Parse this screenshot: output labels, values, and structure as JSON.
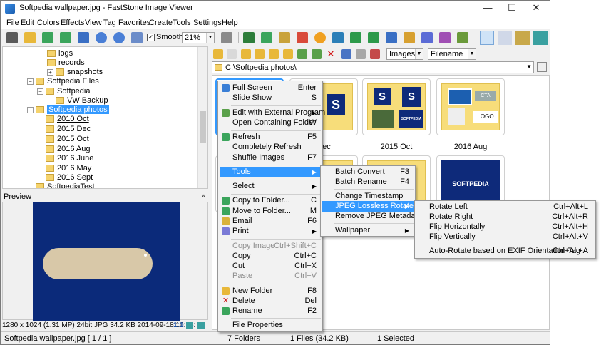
{
  "window": {
    "title": "Softpedia wallpaper.jpg - FastStone Image Viewer",
    "controls": {
      "minimize": "—",
      "maximize": "☐",
      "close": "✕"
    }
  },
  "menubar": [
    "File",
    "Edit",
    "Colors",
    "Effects",
    "View",
    "Tag",
    "Favorites",
    "Create",
    "Tools",
    "Settings",
    "Help"
  ],
  "toolbar": {
    "smooth_label": "Smooth",
    "smooth_checked": "✓",
    "zoom_value": "21%"
  },
  "tree": {
    "items": [
      {
        "label": "logs"
      },
      {
        "label": "records"
      },
      {
        "label": "snapshots"
      },
      {
        "label": "Softpedia Files"
      },
      {
        "label": "Softpedia"
      },
      {
        "label": "VW Backup"
      },
      {
        "label": "Softpedia photos",
        "selected": true
      },
      {
        "label": "2010 Oct"
      },
      {
        "label": "2015 Dec"
      },
      {
        "label": "2015 Oct"
      },
      {
        "label": "2016 Aug"
      },
      {
        "label": "2016 June"
      },
      {
        "label": "2016 May"
      },
      {
        "label": "2016 Sept"
      },
      {
        "label": "SoftpediaTest"
      }
    ]
  },
  "preview": {
    "header": "Preview",
    "info": "1280 x 1024 (1.31 MP)  24bit  JPG   34.2 KB   2014-09-18 10:15:",
    "zoom_ratio": "1:1"
  },
  "browser": {
    "sort_by": "Images",
    "sort_field": "Filename",
    "address": "C:\\Softpedia photos\\",
    "thumbnails": [
      {
        "label": ""
      },
      {
        "label": "Dec"
      },
      {
        "label": "2015 Oct"
      },
      {
        "label": "2016 Aug"
      },
      {
        "label": ""
      },
      {
        "label": ""
      },
      {
        "label": ""
      },
      {
        "label": ""
      }
    ],
    "thumb_texts": {
      "s": "S",
      "cta": "CTA",
      "logo": "LOGO",
      "brand": "SOFTPEDIA",
      "brand_small": "SOFTPEDIA"
    }
  },
  "statusbar": {
    "file": "Softpedia wallpaper.jpg [ 1 / 1 ]",
    "folders": "7 Folders",
    "files": "1 Files (34.2 KB)",
    "selected": "1 Selected"
  },
  "context_menu": {
    "items": [
      {
        "label": "Full Screen",
        "shortcut": "Enter"
      },
      {
        "label": "Slide Show",
        "shortcut": "S"
      },
      {
        "label": "Edit with External Program",
        "shortcut": ""
      },
      {
        "label": "Open Containing Folder",
        "shortcut": "W"
      },
      {
        "label": "Refresh",
        "shortcut": "F5"
      },
      {
        "label": "Completely Refresh",
        "shortcut": ""
      },
      {
        "label": "Shuffle Images",
        "shortcut": "F7"
      },
      {
        "label": "Tools",
        "shortcut": ""
      },
      {
        "label": "Select",
        "shortcut": ""
      },
      {
        "label": "Copy to Folder...",
        "shortcut": "C"
      },
      {
        "label": "Move to Folder...",
        "shortcut": "M"
      },
      {
        "label": "Email",
        "shortcut": "F6"
      },
      {
        "label": "Print",
        "shortcut": ""
      },
      {
        "label": "Copy Image",
        "shortcut": "Ctrl+Shift+C"
      },
      {
        "label": "Copy",
        "shortcut": "Ctrl+C"
      },
      {
        "label": "Cut",
        "shortcut": "Ctrl+X"
      },
      {
        "label": "Paste",
        "shortcut": "Ctrl+V"
      },
      {
        "label": "New Folder",
        "shortcut": "F8"
      },
      {
        "label": "Delete",
        "shortcut": "Del"
      },
      {
        "label": "Rename",
        "shortcut": "F2"
      },
      {
        "label": "File Properties",
        "shortcut": ""
      }
    ]
  },
  "tools_menu": {
    "items": [
      {
        "label": "Batch Convert",
        "shortcut": "F3"
      },
      {
        "label": "Batch Rename",
        "shortcut": "F4"
      },
      {
        "label": "Change Timestamp",
        "shortcut": ""
      },
      {
        "label": "JPEG Lossless Rotate",
        "shortcut": ""
      },
      {
        "label": "Remove JPEG Metadata",
        "shortcut": ""
      },
      {
        "label": "Wallpaper",
        "shortcut": ""
      }
    ]
  },
  "rotate_menu": {
    "items": [
      {
        "label": "Rotate Left",
        "shortcut": "Ctrl+Alt+L"
      },
      {
        "label": "Rotate Right",
        "shortcut": "Ctrl+Alt+R"
      },
      {
        "label": "Flip Horizontally",
        "shortcut": "Ctrl+Alt+H"
      },
      {
        "label": "Flip Vertically",
        "shortcut": "Ctrl+Alt+V"
      },
      {
        "label": "Auto-Rotate based on EXIF Orientation Tag",
        "shortcut": "Ctrl+Alt+A"
      }
    ]
  },
  "colors": {
    "highlight": "#3399ff",
    "folder": "#f5d36c",
    "brand_blue": "#0e2a7a",
    "thumb_bg": "#f7dd7a"
  }
}
